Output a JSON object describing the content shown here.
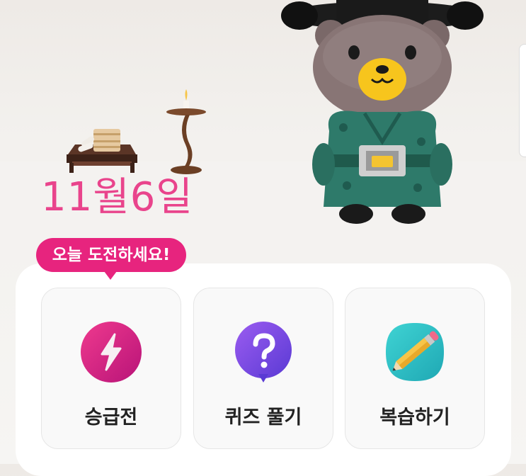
{
  "date_label": "11월6일",
  "challenge_badge": "오늘 도전하세요!",
  "menu": [
    {
      "label": "승급전",
      "icon": "lightning-icon",
      "color": "#d8208c"
    },
    {
      "label": "퀴즈 풀기",
      "icon": "question-icon",
      "color": "#7a4fe0"
    },
    {
      "label": "복습하기",
      "icon": "pencil-icon",
      "color": "#27c1c9"
    }
  ],
  "colors": {
    "accent": "#e7247e",
    "date": "#e9448c"
  }
}
